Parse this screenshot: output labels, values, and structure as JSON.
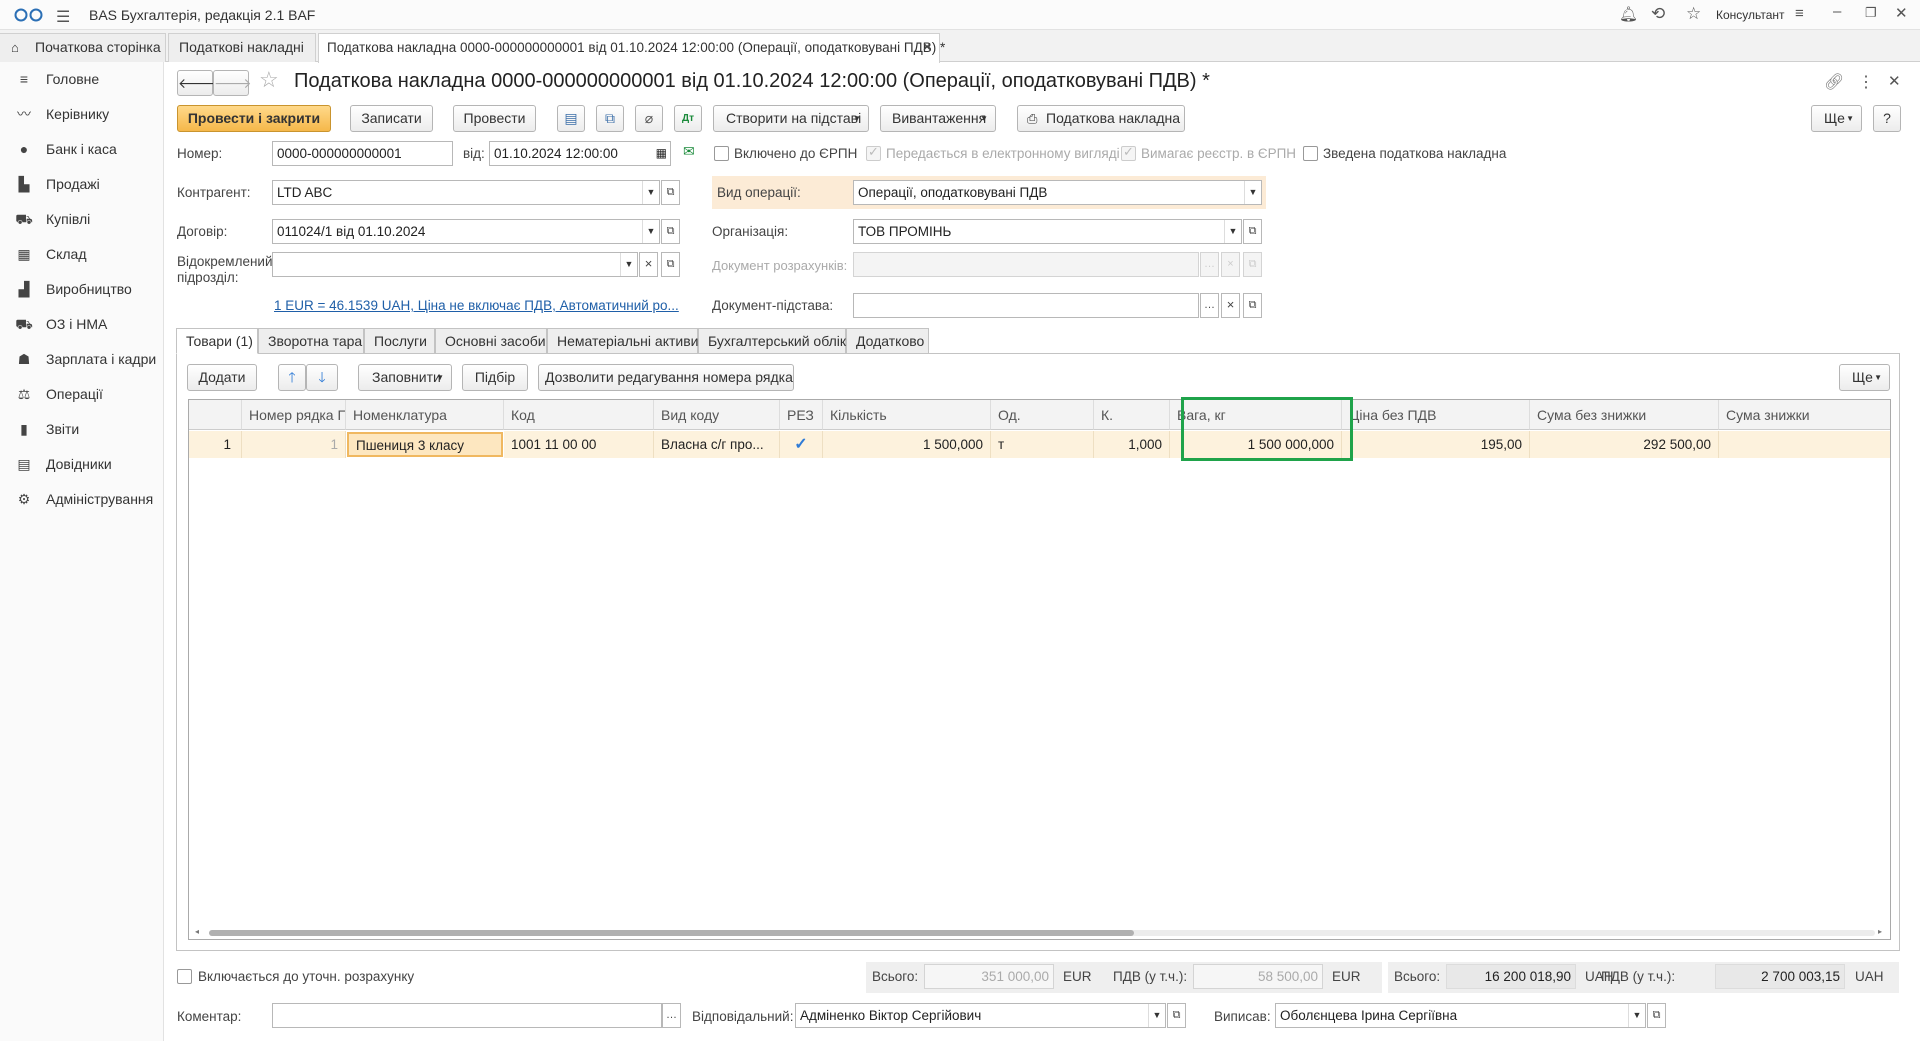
{
  "titlebar": {
    "app_title": "BAS Бухгалтерія, редакція 2.1 BAF",
    "user_name": "Консультант"
  },
  "tabs": [
    {
      "label": "Початкова сторінка"
    },
    {
      "label": "Податкові накладні"
    },
    {
      "label": "Податкова накладна 0000-000000000001 від 01.10.2024 12:00:00 (Операції, оподатковувані ПДВ) *"
    }
  ],
  "sidebar": {
    "items": [
      {
        "label": "Головне",
        "icon": "menu-icon"
      },
      {
        "label": "Керівнику",
        "icon": "chart-line-icon"
      },
      {
        "label": "Банк і каса",
        "icon": "coin-icon"
      },
      {
        "label": "Продажі",
        "icon": "bag-icon"
      },
      {
        "label": "Купівлі",
        "icon": "cart-icon"
      },
      {
        "label": "Склад",
        "icon": "grid-icon"
      },
      {
        "label": "Виробництво",
        "icon": "factory-icon"
      },
      {
        "label": "ОЗ і НМА",
        "icon": "truck-icon"
      },
      {
        "label": "Зарплата і кадри",
        "icon": "person-icon"
      },
      {
        "label": "Операції",
        "icon": "operations-icon"
      },
      {
        "label": "Звіти",
        "icon": "bar-chart-icon"
      },
      {
        "label": "Довідники",
        "icon": "books-icon"
      },
      {
        "label": "Адміністрування",
        "icon": "gear-icon"
      }
    ]
  },
  "document": {
    "title": "Податкова накладна 0000-000000000001 від 01.10.2024 12:00:00 (Операції, оподатковувані ПДВ) *"
  },
  "toolbar": {
    "post_close": "Провести і закрити",
    "save": "Записати",
    "post": "Провести",
    "create_based": "Створити на підставі",
    "upload": "Вивантаження",
    "print_invoice": "Податкова накладна",
    "more": "Ще",
    "help": "?"
  },
  "form": {
    "number_label": "Номер:",
    "number_value": "0000-000000000001",
    "date_label": "від:",
    "date_value": "01.10.2024 12:00:00",
    "erpn_included": "Включено до ЄРПН",
    "electronic": "Передається в електронному вигляді",
    "requires_registration": "Вимагає реєстр. в ЄРПН",
    "summary_invoice": "Зведена податкова накладна",
    "counterparty_label": "Контрагент:",
    "counterparty_value": "LTD ABC",
    "operation_type_label": "Вид операції:",
    "operation_type_value": "Операції, оподатковувані ПДВ",
    "contract_label": "Договір:",
    "contract_value": "011024/1 від 01.10.2024",
    "organization_label": "Організація:",
    "organization_value": "ТОВ ПРОМІНЬ",
    "division_label_1": "Відокремлений",
    "division_label_2": "підрозділ:",
    "division_value": "",
    "settlement_doc_label": "Документ розрахунків:",
    "base_doc_label": "Документ-підстава:",
    "currency_link": "1 EUR = 46.1539 UAH, Ціна не включає ПДВ, Автоматичний ро..."
  },
  "form_tabs": [
    {
      "label": "Товари (1)"
    },
    {
      "label": "Зворотна тара"
    },
    {
      "label": "Послуги"
    },
    {
      "label": "Основні засоби"
    },
    {
      "label": "Нематеріальні активи"
    },
    {
      "label": "Бухгалтерський облік"
    },
    {
      "label": "Додатково"
    }
  ],
  "table_toolbar": {
    "add": "Додати",
    "fill": "Заповнити",
    "select": "Підбір",
    "allow_edit": "Дозволити редагування номера рядка",
    "more": "Ще"
  },
  "table": {
    "columns": [
      "",
      "Номер рядка ПН",
      "Номенклатура",
      "Код",
      "Вид коду",
      "РЕЗ",
      "Кількість",
      "Од.",
      "К.",
      "Вага, кг",
      "Ціна без ПДВ",
      "Сума без знижки",
      "Сума знижки"
    ],
    "rows": [
      {
        "n": "1",
        "line_no": "1",
        "item": "Пшениця 3 класу",
        "code": "1001 11 00 00",
        "code_type": "Власна с/г про...",
        "rez": "✓",
        "quantity": "1 500,000",
        "unit": "т",
        "coef": "1,000",
        "weight": "1 500 000,000",
        "price": "195,00",
        "sum_no_discount": "292 500,00",
        "discount": ""
      }
    ]
  },
  "highlight_color": "#1fa34a",
  "footer": {
    "included_label": "Включається до уточн. розрахунку",
    "total_label_1": "Всього:",
    "total_eur": "351 000,00",
    "currency_eur_1": "EUR",
    "vat_label_1": "ПДВ (у т.ч.):",
    "vat_eur": "58 500,00",
    "currency_eur_2": "EUR",
    "total_label_2": "Всього:",
    "total_uah": "16 200 018,90",
    "currency_uah_1": "UAH",
    "vat_label_2": "ПДВ (у т.ч.):",
    "vat_uah": "2 700 003,15",
    "currency_uah_2": "UAH",
    "comment_label": "Коментар:",
    "comment_value": "",
    "responsible_label": "Відповідальний:",
    "responsible_value": "Адміненко Віктор Сергійович",
    "issued_label": "Виписав:",
    "issued_value": "Оболєнцева Ірина Сергіївна"
  }
}
